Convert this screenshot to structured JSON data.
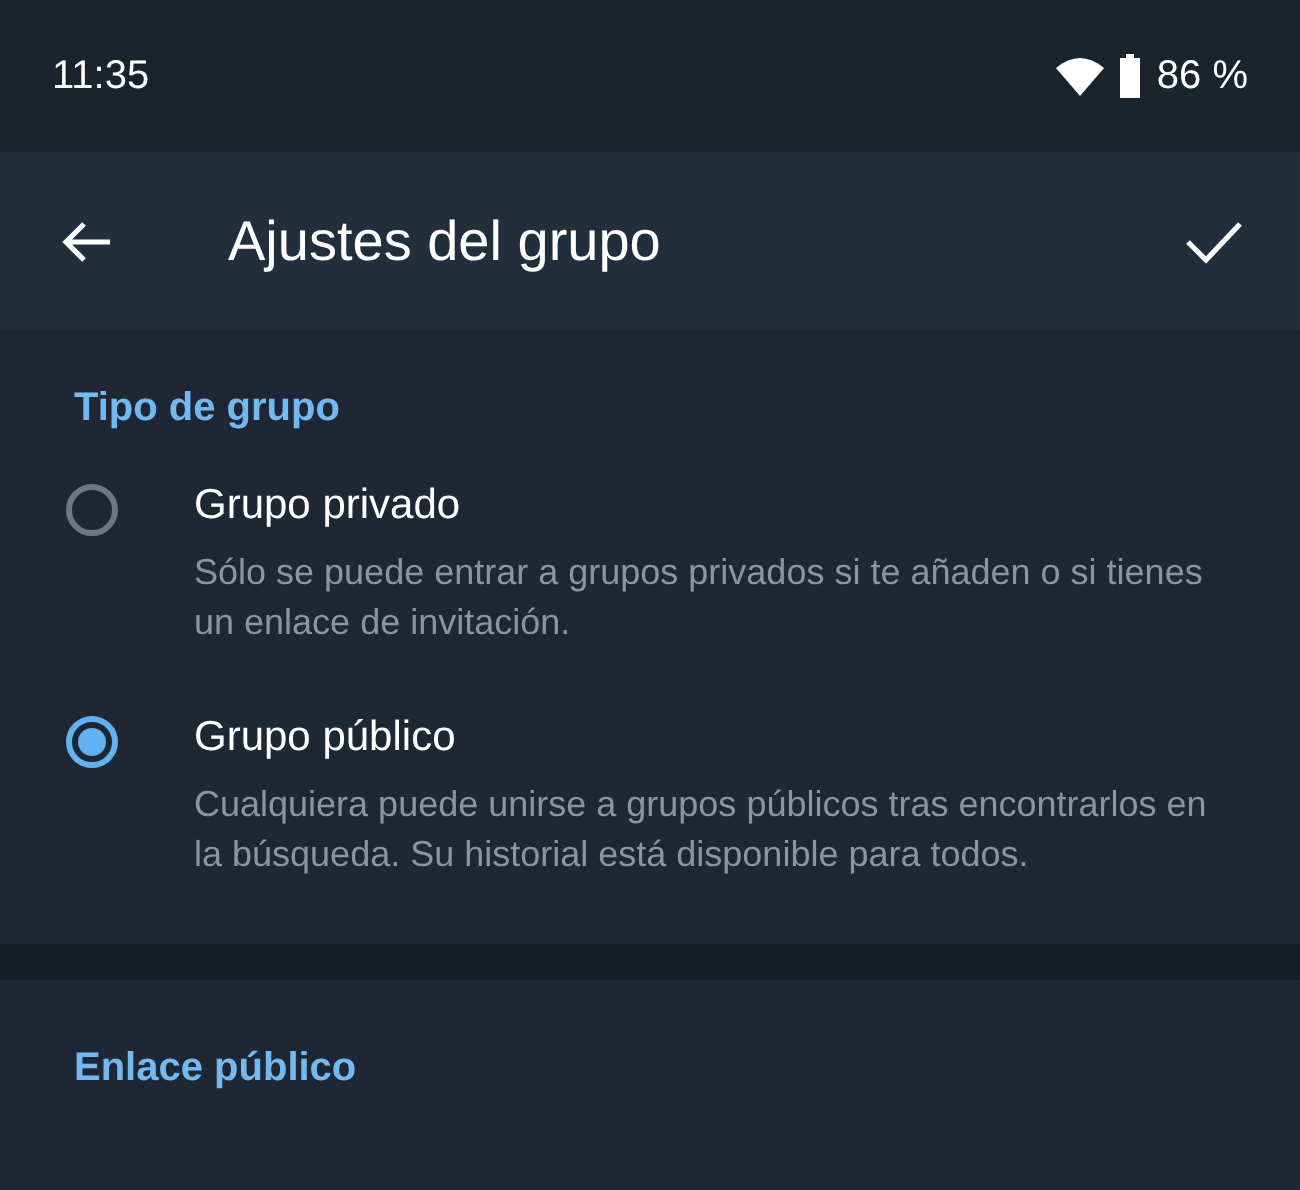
{
  "status_bar": {
    "time": "11:35",
    "battery": "86 %"
  },
  "app_bar": {
    "title": "Ajustes del grupo"
  },
  "section": {
    "header": "Tipo de grupo",
    "options": [
      {
        "title": "Grupo privado",
        "description": "Sólo se puede entrar a grupos privados si te añaden o si tienes un enlace de invitación.",
        "selected": false
      },
      {
        "title": "Grupo público",
        "description": "Cualquiera puede unirse a grupos públicos tras encontrarlos en la búsqueda. Su historial está disponible para todos.",
        "selected": true
      }
    ]
  },
  "next_section": {
    "header": "Enlace público"
  }
}
